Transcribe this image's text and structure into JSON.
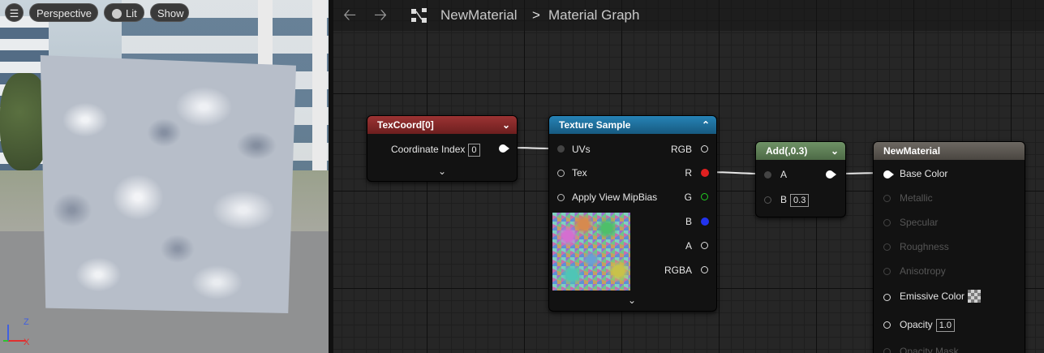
{
  "viewport": {
    "perspective_label": "Perspective",
    "lit_label": "Lit",
    "show_label": "Show",
    "axis_z": "Z",
    "axis_x": "X"
  },
  "graph": {
    "breadcrumb_asset": "NewMaterial",
    "breadcrumb_separator": ">",
    "breadcrumb_graph": "Material Graph"
  },
  "nodes": {
    "texcoord": {
      "title": "TexCoord[0]",
      "coordinate_label": "Coordinate Index",
      "coordinate_value": "0"
    },
    "texture_sample": {
      "title": "Texture Sample",
      "inputs": [
        "UVs",
        "Tex",
        "Apply View MipBias"
      ],
      "outputs": [
        "RGB",
        "R",
        "G",
        "B",
        "A",
        "RGBA"
      ]
    },
    "add": {
      "title": "Add(,0.3)",
      "input_a": "A",
      "input_b": "B",
      "b_value": "0.3"
    },
    "result": {
      "title": "NewMaterial",
      "base_color": "Base Color",
      "metallic": "Metallic",
      "specular": "Specular",
      "roughness": "Roughness",
      "anisotropy": "Anisotropy",
      "emissive_color": "Emissive Color",
      "opacity": "Opacity",
      "opacity_value": "1.0",
      "opacity_mask": "Opacity Mask"
    }
  },
  "colors": {
    "texcoord_header": "#8a2a2a",
    "texture_header": "#1f6f9c",
    "add_header": "#5f7f56",
    "result_header": "#5e5a54",
    "pin_red": "#e02020",
    "pin_green": "#22cc22",
    "pin_blue": "#2233ee"
  }
}
